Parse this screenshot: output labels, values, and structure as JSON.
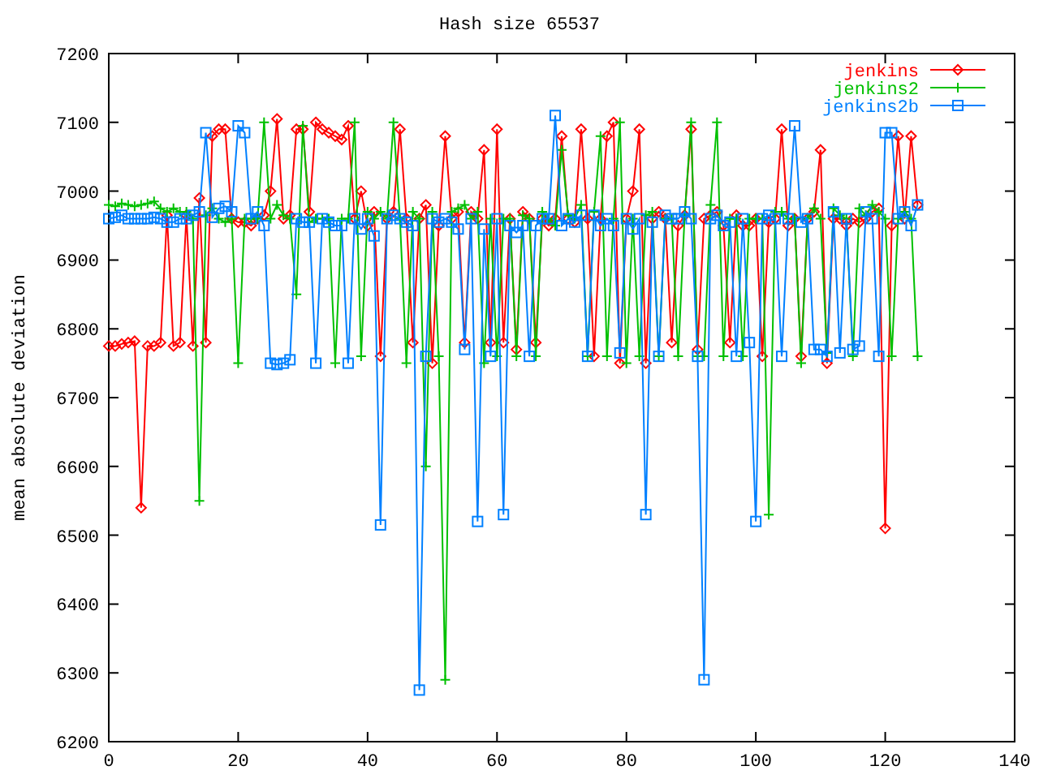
{
  "chart_data": {
    "type": "line",
    "title": "Hash size 65537",
    "ylabel": "mean absolute deviation",
    "x": [
      0,
      1,
      2,
      3,
      4,
      5,
      6,
      7,
      8,
      9,
      10,
      11,
      12,
      13,
      14,
      15,
      16,
      17,
      18,
      19,
      20,
      21,
      22,
      23,
      24,
      25,
      26,
      27,
      28,
      29,
      30,
      31,
      32,
      33,
      34,
      35,
      36,
      37,
      38,
      39,
      40,
      41,
      42,
      43,
      44,
      45,
      46,
      47,
      48,
      49,
      50,
      51,
      52,
      53,
      54,
      55,
      56,
      57,
      58,
      59,
      60,
      61,
      62,
      63,
      64,
      65,
      66,
      67,
      68,
      69,
      70,
      71,
      72,
      73,
      74,
      75,
      76,
      77,
      78,
      79,
      80,
      81,
      82,
      83,
      84,
      85,
      86,
      87,
      88,
      89,
      90,
      91,
      92,
      93,
      94,
      95,
      96,
      97,
      98,
      99,
      100,
      101,
      102,
      103,
      104,
      105,
      106,
      107,
      108,
      109,
      110,
      111,
      112,
      113,
      114,
      115,
      116,
      117,
      118,
      119,
      120,
      121,
      122,
      123,
      124,
      125
    ],
    "legend": true,
    "xlim": [
      0,
      140
    ],
    "ylim": [
      6200,
      7200
    ],
    "xticks": [
      0,
      20,
      40,
      60,
      80,
      100,
      120,
      140
    ],
    "yticks": [
      6200,
      6300,
      6400,
      6500,
      6600,
      6700,
      6800,
      6900,
      7000,
      7100,
      7200
    ],
    "series": [
      {
        "name": "jenkins",
        "color": "#ff0000",
        "marker": "diamond",
        "values": [
          6775,
          6775,
          6778,
          6780,
          6782,
          6540,
          6775,
          6775,
          6780,
          6965,
          6775,
          6780,
          6965,
          6775,
          6990,
          6780,
          7080,
          7090,
          7090,
          6960,
          6955,
          6955,
          6950,
          6960,
          6965,
          7000,
          7105,
          6960,
          6965,
          7090,
          7090,
          6970,
          7100,
          7090,
          7085,
          7080,
          7075,
          7095,
          6960,
          7000,
          6950,
          6970,
          6760,
          6960,
          6970,
          7090,
          6960,
          6780,
          6960,
          6980,
          6750,
          6950,
          7080,
          6960,
          6970,
          6780,
          6970,
          6960,
          7060,
          6780,
          7090,
          6780,
          6960,
          6770,
          6970,
          6960,
          6780,
          6960,
          6950,
          6960,
          7080,
          6960,
          6955,
          7090,
          6960,
          6760,
          6960,
          7080,
          7100,
          6750,
          6960,
          7000,
          7090,
          6750,
          6960,
          6970,
          6960,
          6780,
          6950,
          6965,
          7090,
          6770,
          6960,
          6965,
          6970,
          6950,
          6780,
          6965,
          6950,
          6950,
          6960,
          6760,
          6955,
          6960,
          7090,
          6950,
          6960,
          6760,
          6960,
          6970,
          7060,
          6750,
          6960,
          6960,
          6950,
          6960,
          6955,
          6960,
          6970,
          6975,
          6510,
          6950,
          7080,
          6960,
          7080,
          6980
        ]
      },
      {
        "name": "jenkins2",
        "color": "#00c000",
        "marker": "plus",
        "values": [
          6980,
          6978,
          6982,
          6980,
          6978,
          6980,
          6982,
          6985,
          6975,
          6970,
          6975,
          6970,
          6970,
          6960,
          6550,
          6965,
          6975,
          6960,
          6955,
          6960,
          6750,
          6960,
          6960,
          6960,
          7100,
          6960,
          6980,
          6965,
          6960,
          6850,
          7095,
          6955,
          6960,
          6960,
          6960,
          6750,
          6960,
          6960,
          7100,
          6760,
          6970,
          6960,
          6970,
          6960,
          7100,
          6960,
          6750,
          6970,
          6960,
          6600,
          6970,
          6760,
          6290,
          6970,
          6975,
          6980,
          6960,
          6970,
          6750,
          6960,
          6760,
          6960,
          6960,
          6760,
          6965,
          6960,
          6760,
          6970,
          6960,
          6950,
          7060,
          6965,
          6960,
          6980,
          6760,
          6970,
          7080,
          6760,
          6960,
          7100,
          6750,
          6960,
          6760,
          6965,
          6970,
          6760,
          6960,
          6960,
          6760,
          6965,
          7100,
          6760,
          6760,
          6980,
          7100,
          6760,
          6960,
          6960,
          6760,
          6960,
          6960,
          6960,
          6530,
          6970,
          6970,
          6960,
          6960,
          6750,
          6960,
          6975,
          6960,
          6765,
          6975,
          6965,
          6960,
          6760,
          6975,
          6965,
          6980,
          6970,
          6960,
          6760,
          6960,
          6970,
          6960,
          6760
        ]
      },
      {
        "name": "jenkins2b",
        "color": "#0080ff",
        "marker": "square",
        "values": [
          6960,
          6962,
          6965,
          6960,
          6960,
          6960,
          6960,
          6962,
          6960,
          6955,
          6955,
          6960,
          6960,
          6965,
          6970,
          7085,
          6962,
          6975,
          6978,
          6970,
          7095,
          7085,
          6960,
          6970,
          6950,
          6750,
          6748,
          6750,
          6755,
          6960,
          6955,
          6955,
          6750,
          6960,
          6955,
          6950,
          6950,
          6750,
          6960,
          6945,
          6960,
          6935,
          6515,
          6960,
          6965,
          6960,
          6955,
          6950,
          6275,
          6760,
          6960,
          6955,
          6960,
          6955,
          6945,
          6770,
          6960,
          6520,
          6945,
          6760,
          6960,
          6530,
          6950,
          6940,
          6950,
          6760,
          6950,
          6960,
          6960,
          7110,
          6950,
          6960,
          6955,
          6965,
          6760,
          6965,
          6950,
          6960,
          6950,
          6765,
          6960,
          6945,
          6960,
          6530,
          6955,
          6760,
          6965,
          6960,
          6960,
          6970,
          6960,
          6760,
          6290,
          6960,
          6965,
          6950,
          6955,
          6760,
          6960,
          6780,
          6520,
          6960,
          6965,
          6960,
          6760,
          6960,
          7095,
          6955,
          6960,
          6770,
          6770,
          6760,
          6970,
          6765,
          6960,
          6770,
          6775,
          6970,
          6960,
          6760,
          7085,
          7085,
          6960,
          6970,
          6950,
          6980
        ]
      }
    ]
  }
}
